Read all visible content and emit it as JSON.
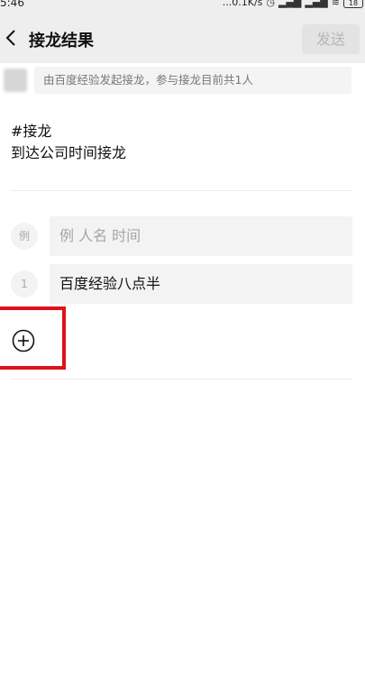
{
  "status_bar": {
    "time": "5:46",
    "network_speed": "...0.1K/s",
    "battery": "18"
  },
  "nav": {
    "title": "接龙结果",
    "send_label": "发送"
  },
  "initiator": {
    "text": "由百度经验发起接龙，参与接龙目前共1人"
  },
  "topic": {
    "tag": "#接龙",
    "description": "到达公司时间接龙"
  },
  "entries": [
    {
      "index": "例",
      "text": "例 人名 时间",
      "is_placeholder": true
    },
    {
      "index": "1",
      "text": "百度经验八点半",
      "is_placeholder": false
    }
  ],
  "icons": {
    "back": "chevron-left-icon",
    "add": "plus-circle-icon"
  },
  "colors": {
    "highlight": "#e0111a",
    "nav_background": "#eeeeee",
    "send_disabled_text": "#b6b6b6"
  }
}
